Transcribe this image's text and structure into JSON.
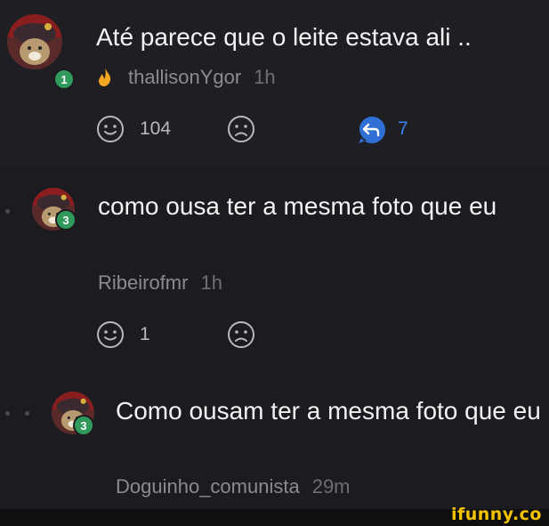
{
  "colors": {
    "background": "#1c1c20",
    "badge": "#2f9a5c",
    "reply_accent": "#2f6fd6",
    "brand": "#f5c400"
  },
  "comments": [
    {
      "text": "Até parece que o leite estava ali ..",
      "username": "thallisonYgor",
      "time": "1h",
      "level": "1",
      "author_icon": "flame-icon",
      "likes": "104",
      "replies": "7"
    },
    {
      "text": "como ousa ter a mesma foto que eu",
      "username": "Ribeirofmr",
      "time": "1h",
      "level": "3",
      "likes": "1"
    },
    {
      "text": "Como ousam ter a mesma foto que eu",
      "username": "Doguinho_comunista",
      "time": "29m",
      "level": "3"
    }
  ],
  "brand": "ifunny.co"
}
